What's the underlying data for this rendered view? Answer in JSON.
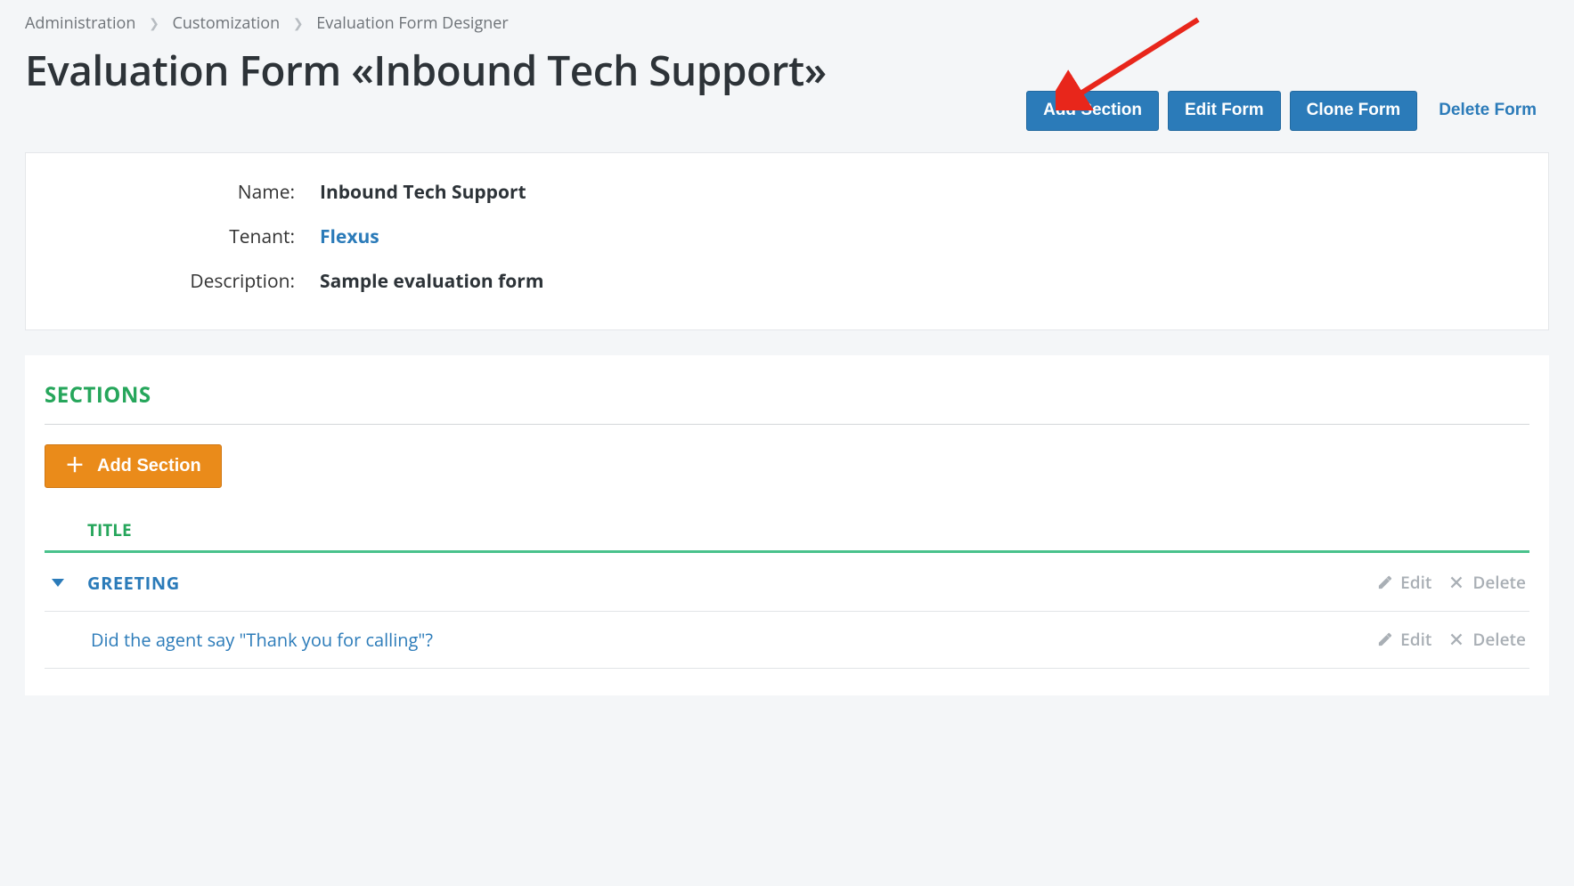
{
  "breadcrumb": {
    "items": [
      "Administration",
      "Customization",
      "Evaluation Form Designer"
    ]
  },
  "page_title": "Evaluation Form «Inbound Tech Support»",
  "actions": {
    "add_section": "Add Section",
    "edit_form": "Edit Form",
    "clone_form": "Clone Form",
    "delete_form": "Delete Form"
  },
  "details": {
    "name_label": "Name:",
    "name_value": "Inbound Tech Support",
    "tenant_label": "Tenant:",
    "tenant_value": "Flexus",
    "description_label": "Description:",
    "description_value": "Sample evaluation form"
  },
  "sections_panel": {
    "heading": "SECTIONS",
    "add_button": "Add Section",
    "column_title": "TITLE"
  },
  "section_row": {
    "title": "GREETING",
    "edit": "Edit",
    "delete": "Delete"
  },
  "question_row": {
    "title": "Did the agent say \"Thank you for calling\"?",
    "edit": "Edit",
    "delete": "Delete"
  }
}
